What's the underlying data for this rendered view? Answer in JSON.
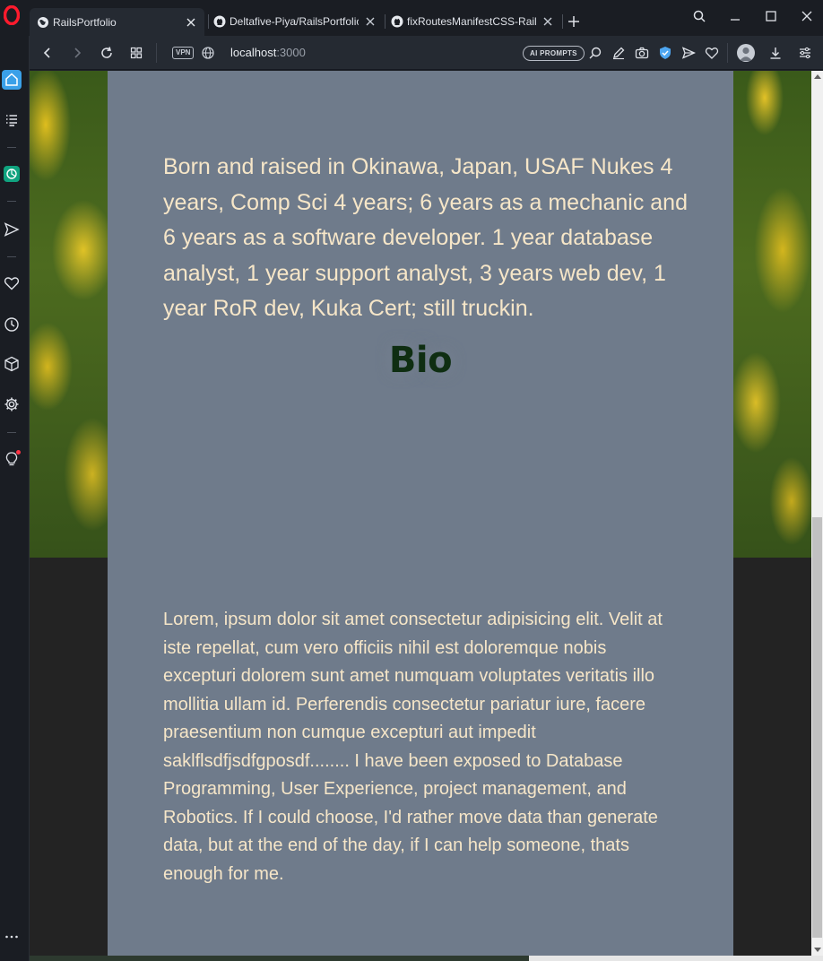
{
  "browser": {
    "tabs": [
      {
        "title": "RailsPortfolio",
        "active": true,
        "favicon": "globe-icon"
      },
      {
        "title": "Deltafive-Piya/RailsPortfolio",
        "active": false,
        "favicon": "github-icon"
      },
      {
        "title": "fixRoutesManifestCSS-Rails",
        "active": false,
        "favicon": "github-icon"
      }
    ],
    "address": {
      "vpn_label": "VPN",
      "url_host": "localhost",
      "url_port": ":3000",
      "ai_prompts_label": "AI PROMPTS"
    }
  },
  "page": {
    "tagline": "Born and raised in Okinawa, Japan, USAF Nukes 4 years, Comp Sci 4 years; 6 years as a mechanic and 6 years as a software developer. 1 year database analyst, 1 year support analyst, 3 years web dev, 1 year RoR dev, Kuka Cert; still truckin.",
    "bio_heading": "Bio",
    "bio_text": "Lorem, ipsum dolor sit amet consectetur adipisicing elit. Velit at iste repellat, cum vero officiis nihil est doloremque nobis excepturi dolorem sunt amet numquam voluptates veritatis illo mollitia ullam id. Perferendis consectetur pariatur iure, facere praesentium non cumque excepturi aut impedit saklflsdfjsdfgposdf........ I have been exposed to Database Programming, User Experience, project management, and Robotics. If I could choose, I'd rather move data than generate data, but at the end of the day, if I can help someone, thats enough for me."
  },
  "colors": {
    "card_background": "#6f7b8b",
    "text_cream": "#f6e6c8",
    "heading_green": "#0f2e12",
    "sidebar_accent": "#3aa0e8"
  }
}
